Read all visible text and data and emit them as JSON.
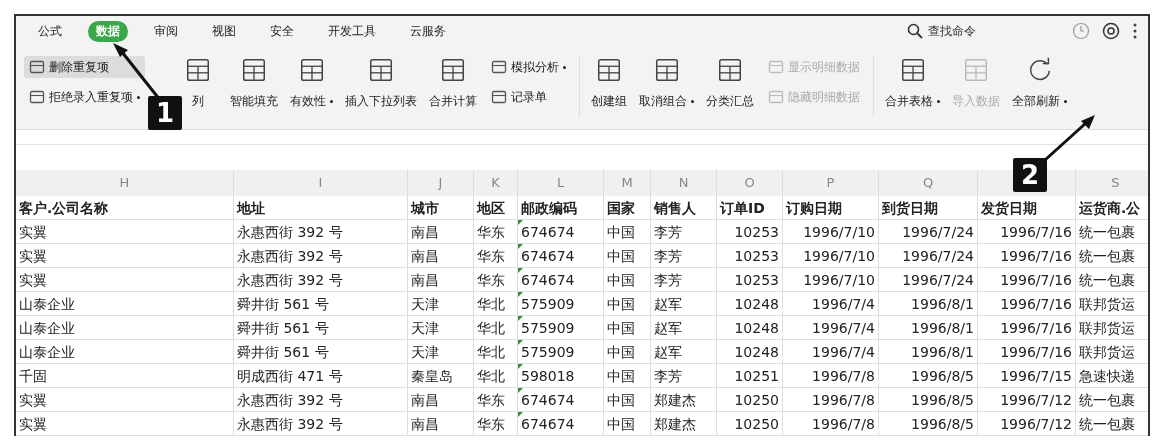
{
  "tabs": [
    {
      "label": "公式",
      "selected": false
    },
    {
      "label": "数据",
      "selected": true
    },
    {
      "label": "审阅",
      "selected": false
    },
    {
      "label": "视图",
      "selected": false
    },
    {
      "label": "安全",
      "selected": false
    },
    {
      "label": "开发工具",
      "selected": false
    },
    {
      "label": "云服务",
      "selected": false
    }
  ],
  "search": {
    "placeholder": "查找命令"
  },
  "ribbon": [
    {
      "blocks": [
        {
          "kind": "stack",
          "items": [
            {
              "label": "删除重复项",
              "highlighted": true,
              "dropdown": false,
              "disabled": false
            },
            {
              "label": "拒绝录入重复项",
              "highlighted": false,
              "dropdown": true,
              "disabled": false
            }
          ]
        },
        {
          "kind": "large",
          "label": "列",
          "dropdown": false,
          "disabled": false
        },
        {
          "kind": "large",
          "label": "智能填充",
          "dropdown": false,
          "disabled": false
        },
        {
          "kind": "large",
          "label": "有效性",
          "dropdown": true,
          "disabled": false
        },
        {
          "kind": "large",
          "label": "插入下拉列表",
          "dropdown": false,
          "disabled": false
        },
        {
          "kind": "large",
          "label": "合并计算",
          "dropdown": false,
          "disabled": false
        },
        {
          "kind": "stack",
          "items": [
            {
              "label": "模拟分析",
              "highlighted": false,
              "dropdown": true,
              "disabled": false
            },
            {
              "label": "记录单",
              "highlighted": false,
              "dropdown": false,
              "disabled": false
            }
          ]
        }
      ]
    },
    {
      "blocks": [
        {
          "kind": "large",
          "label": "创建组",
          "dropdown": false,
          "disabled": false
        },
        {
          "kind": "large",
          "label": "取消组合",
          "dropdown": true,
          "disabled": false
        },
        {
          "kind": "large",
          "label": "分类汇总",
          "dropdown": false,
          "disabled": false
        },
        {
          "kind": "stack",
          "items": [
            {
              "label": "显示明细数据",
              "highlighted": false,
              "dropdown": false,
              "disabled": true
            },
            {
              "label": "隐藏明细数据",
              "highlighted": false,
              "dropdown": false,
              "disabled": true
            }
          ]
        }
      ]
    },
    {
      "blocks": [
        {
          "kind": "large",
          "label": "合并表格",
          "dropdown": true,
          "disabled": false
        },
        {
          "kind": "large",
          "label": "导入数据",
          "dropdown": false,
          "disabled": true
        },
        {
          "kind": "large",
          "label": "全部刷新",
          "dropdown": true,
          "disabled": false
        }
      ]
    }
  ],
  "table": {
    "columns": [
      {
        "letter": "H",
        "header": "客户.公司名称"
      },
      {
        "letter": "I",
        "header": "地址"
      },
      {
        "letter": "J",
        "header": "城市"
      },
      {
        "letter": "K",
        "header": "地区"
      },
      {
        "letter": "L",
        "header": "邮政编码"
      },
      {
        "letter": "M",
        "header": "国家"
      },
      {
        "letter": "N",
        "header": "销售人"
      },
      {
        "letter": "O",
        "header": "订单ID"
      },
      {
        "letter": "P",
        "header": "订购日期"
      },
      {
        "letter": "Q",
        "header": "到货日期"
      },
      {
        "header": "发货日期"
      },
      {
        "letter": "S",
        "header": "运货商.公"
      }
    ],
    "rows": [
      [
        "实翼",
        "永惠西街 392 号",
        "南昌",
        "华东",
        "674674",
        "中国",
        "李芳",
        "10253",
        "1996/7/10",
        "1996/7/24",
        "1996/7/16",
        "统一包裹"
      ],
      [
        "实翼",
        "永惠西街 392 号",
        "南昌",
        "华东",
        "674674",
        "中国",
        "李芳",
        "10253",
        "1996/7/10",
        "1996/7/24",
        "1996/7/16",
        "统一包裹"
      ],
      [
        "实翼",
        "永惠西街 392 号",
        "南昌",
        "华东",
        "674674",
        "中国",
        "李芳",
        "10253",
        "1996/7/10",
        "1996/7/24",
        "1996/7/16",
        "统一包裹"
      ],
      [
        "山泰企业",
        "舜井街 561 号",
        "天津",
        "华北",
        "575909",
        "中国",
        "赵军",
        "10248",
        "1996/7/4",
        "1996/8/1",
        "1996/7/16",
        "联邦货运"
      ],
      [
        "山泰企业",
        "舜井街 561 号",
        "天津",
        "华北",
        "575909",
        "中国",
        "赵军",
        "10248",
        "1996/7/4",
        "1996/8/1",
        "1996/7/16",
        "联邦货运"
      ],
      [
        "山泰企业",
        "舜井街 561 号",
        "天津",
        "华北",
        "575909",
        "中国",
        "赵军",
        "10248",
        "1996/7/4",
        "1996/8/1",
        "1996/7/16",
        "联邦货运"
      ],
      [
        "千固",
        "明成西街 471 号",
        "秦皇岛",
        "华北",
        "598018",
        "中国",
        "李芳",
        "10251",
        "1996/7/8",
        "1996/8/5",
        "1996/7/15",
        "急速快递"
      ],
      [
        "实翼",
        "永惠西街 392 号",
        "南昌",
        "华东",
        "674674",
        "中国",
        "郑建杰",
        "10250",
        "1996/7/8",
        "1996/8/5",
        "1996/7/12",
        "统一包裹"
      ],
      [
        "实翼",
        "永惠西街 392 号",
        "南昌",
        "华东",
        "674674",
        "中国",
        "郑建杰",
        "10250",
        "1996/7/8",
        "1996/8/5",
        "1996/7/12",
        "统一包裹"
      ]
    ]
  },
  "annotations": [
    {
      "label": "1"
    },
    {
      "label": "2"
    }
  ]
}
